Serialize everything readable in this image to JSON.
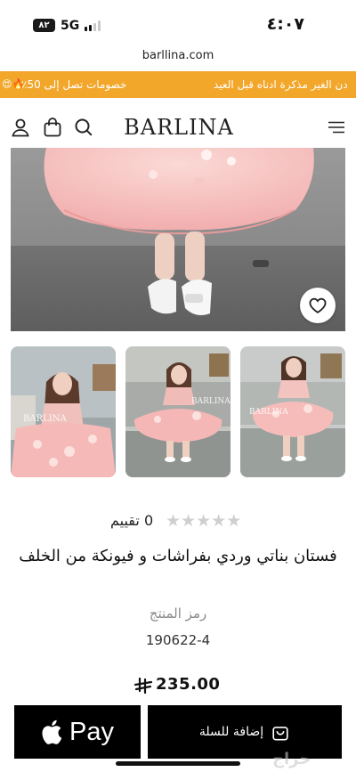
{
  "status_bar": {
    "time": "٤:٠٧",
    "network": "5G",
    "battery": "٨٢"
  },
  "browser": {
    "url": "barllina.com"
  },
  "promo_banner": {
    "text_1": "خصومات تصل إلى 50٪",
    "text_2": "دن الغير مذكرة ادناه قبل العيد",
    "emoji": "😍🔥"
  },
  "header": {
    "logo": "BARLINA",
    "icons": [
      "user-icon",
      "cart-bag-icon",
      "search-icon",
      "menu-icon"
    ]
  },
  "product": {
    "gallery": {
      "thumbnail_watermark": "BARLINA"
    },
    "rating_count": "0",
    "rating_label": "تقييم",
    "stars_filled": 0,
    "stars_total": 5,
    "title": "فستان بناتي وردي بفراشات و فيونكة من الخلف",
    "sku_label": "رمز المنتج",
    "sku": "190622-4",
    "price": "235.00"
  },
  "actions": {
    "apple_pay": "Pay",
    "add_to_cart": "إضافة للسلة"
  },
  "watermark": "حراج",
  "colors": {
    "banner": "#f2a72b",
    "button": "#000000",
    "dress_pink": "#f3b5b5"
  }
}
